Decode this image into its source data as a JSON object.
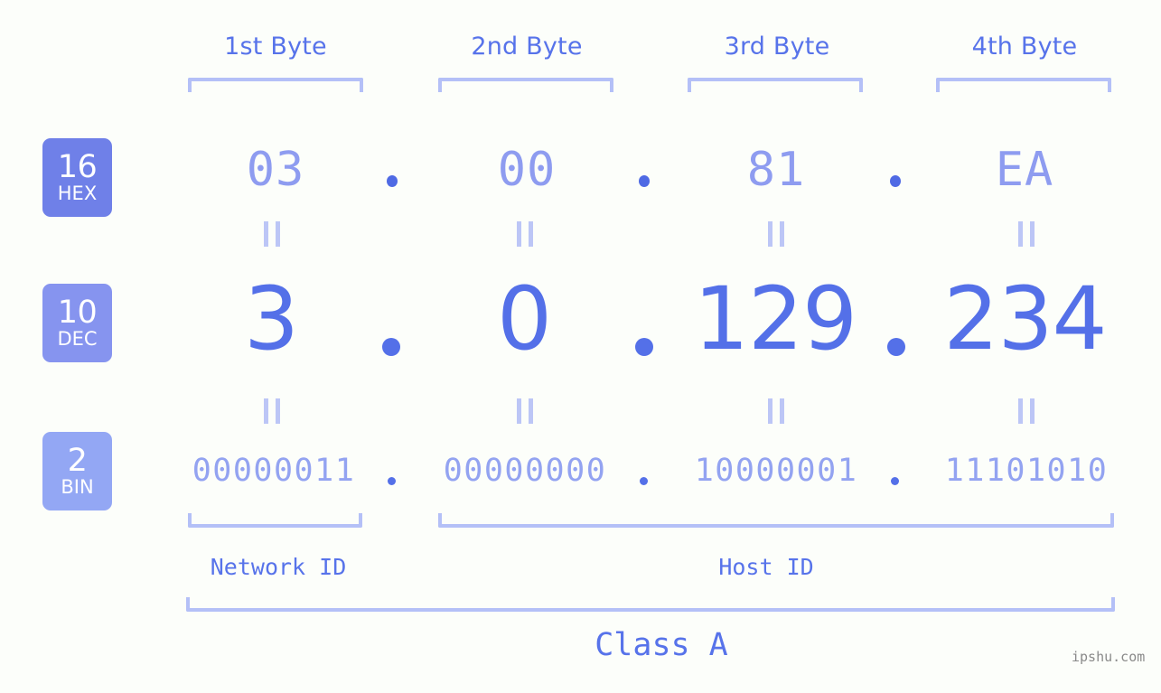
{
  "meta": {
    "watermark": "ipshu.com",
    "accent_strong": "#5470e8",
    "accent_mid": "#8e9cf0",
    "accent_light": "#b4c0f7",
    "background": "#fcfefa"
  },
  "byte_headers": [
    {
      "label": "1st Byte"
    },
    {
      "label": "2nd Byte"
    },
    {
      "label": "3rd Byte"
    },
    {
      "label": "4th Byte"
    }
  ],
  "bases": [
    {
      "num": "16",
      "abbr": "HEX"
    },
    {
      "num": "10",
      "abbr": "DEC"
    },
    {
      "num": "2",
      "abbr": "BIN"
    }
  ],
  "rows": {
    "hex": {
      "base_num": "16",
      "base_abbr": "HEX",
      "values": [
        "03",
        "00",
        "81",
        "EA"
      ],
      "separator": "."
    },
    "dec": {
      "base_num": "10",
      "base_abbr": "DEC",
      "values": [
        "3",
        "0",
        "129",
        "234"
      ],
      "separator": ".",
      "address": "3.0.129.234"
    },
    "bin": {
      "base_num": "2",
      "base_abbr": "BIN",
      "values": [
        "00000011",
        "00000000",
        "10000001",
        "11101010"
      ],
      "separator": ".",
      "address": "00000011.00000000.10000001.11101010"
    }
  },
  "equality_marks": {
    "symbol": "=",
    "count_per_row": 4
  },
  "segments": {
    "network_id": {
      "label": "Network ID",
      "bytes": 1
    },
    "host_id": {
      "label": "Host ID",
      "bytes": 3
    },
    "class": {
      "label": "Class A"
    }
  }
}
